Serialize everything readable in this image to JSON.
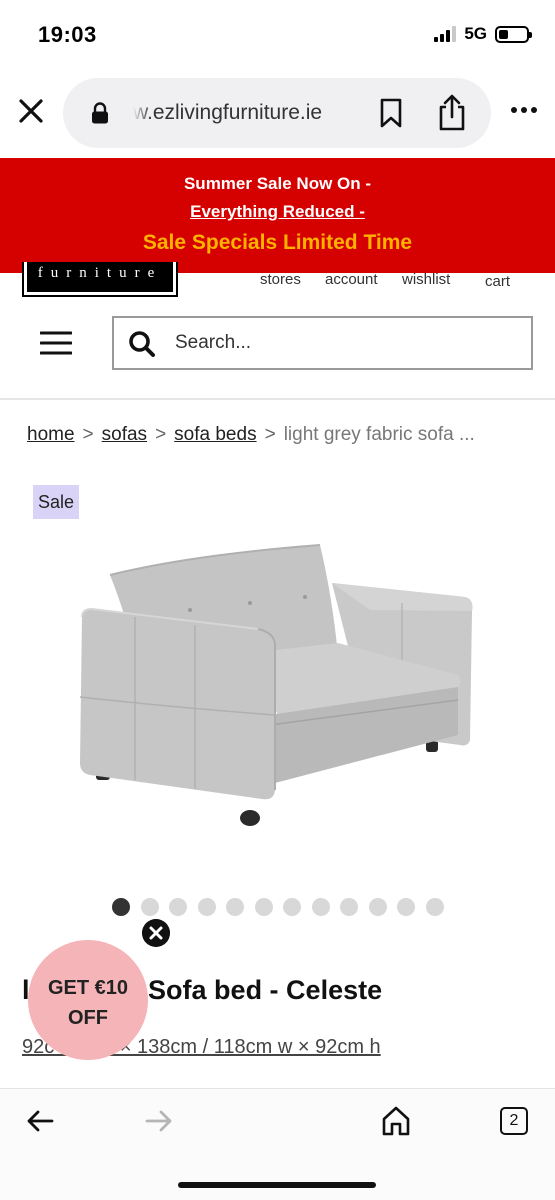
{
  "status_bar": {
    "time": "19:03",
    "network": "5G",
    "signal_bars_filled": 3,
    "signal_bars_total": 4,
    "battery_level": 0.35
  },
  "browser": {
    "url": "w.ezlivingfurniture.ie",
    "icons": [
      "close-icon",
      "lock-icon",
      "bookmark-icon",
      "share-icon",
      "more-icon"
    ]
  },
  "promo_banner": {
    "line1": "Summer Sale Now On -",
    "line2": "Everything Reduced -",
    "line3": "Sale Specials Limited Time",
    "background": "#d50000",
    "highlight_color": "#ffb300"
  },
  "site_header": {
    "logo_text": "furniture",
    "nav": {
      "stores": "stores",
      "account": "account",
      "wishlist": "wishlist",
      "cart": "cart"
    },
    "search_placeholder": "Search..."
  },
  "breadcrumb": {
    "items": [
      "home",
      "sofas",
      "sofa beds"
    ],
    "separator": ">",
    "current": "light grey fabric sofa ..."
  },
  "product": {
    "badge": "Sale",
    "badge_color": "#d9d3f7",
    "title": "Light Grey Fabric Sofa bed - Celeste",
    "title_visible": "l         y Fabric Sofa bed - Celeste",
    "dimensions": "92cm / 87cm d × 138cm / 118cm w × 92cm h",
    "dimensions_visible": "92c        7cm d × 138cm / 118cm w × 92cm h",
    "image_count": 12,
    "active_image_index": 0
  },
  "promo_bubble": {
    "line1": "GET €10",
    "line2": "OFF",
    "color": "#f5b5b8"
  },
  "toolbar": {
    "tab_count": "2"
  }
}
